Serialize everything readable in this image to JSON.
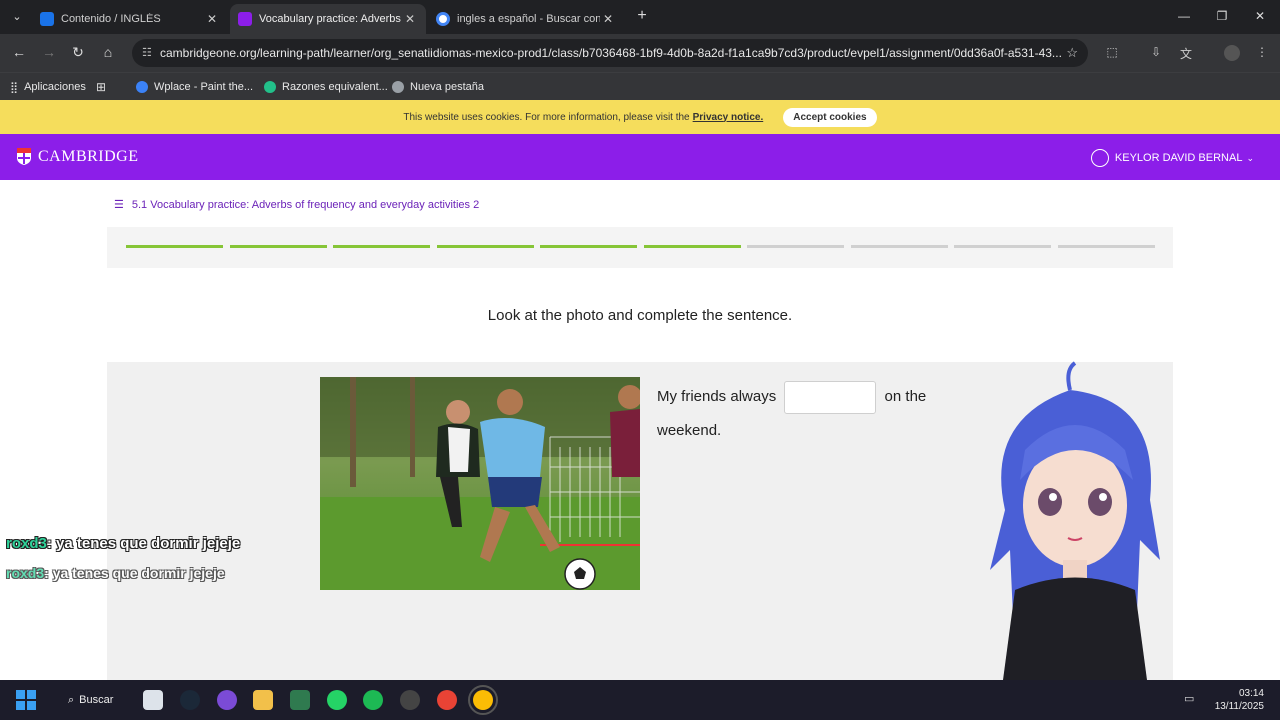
{
  "browser": {
    "tabs": [
      {
        "title": "Contenido / INGLÉS",
        "active": false,
        "favicon_color": "#1a73e8"
      },
      {
        "title": "Vocabulary practice: Adverbs of",
        "active": true,
        "favicon_color": "#8c1ee9"
      },
      {
        "title": "ingles a español - Buscar con G",
        "active": false,
        "favicon_color": "#4285f4"
      }
    ],
    "url": "cambridgeone.org/learning-path/learner/org_senatiidiomas-mexico-prod1/class/b7036468-1bf9-4d0b-8a2d-f1a1ca9b7cd3/product/evpel1/assignment/0dd36a0f-a531-43...",
    "bookmarks": [
      "Aplicaciones",
      "Wplace - Paint the...",
      "Razones equivalent...",
      "Nueva pestaña"
    ]
  },
  "cookie": {
    "message": "This website uses cookies. For more information, please visit the",
    "link": "Privacy notice.",
    "accept_label": "Accept cookies"
  },
  "header": {
    "logo_text": "CAMBRIDGE",
    "user_name": "KEYLOR DAVID BERNAL",
    "brand_color": "#8c1ee9"
  },
  "activity": {
    "breadcrumb": "5.1 Vocabulary practice: Adverbs of frequency and everyday activities 2",
    "progress": {
      "total": 10,
      "completed": 6
    },
    "instruction": "Look at the photo and complete the sentence.",
    "sentence_before": "My friends always",
    "sentence_after": "on the weekend.",
    "answer_value": ""
  },
  "overlay_chat": [
    {
      "user": "roxd3",
      "message": ": ya tenes que dormir jejeje"
    },
    {
      "user": "roxd3",
      "message": ": ya tenes que dormir jejeje"
    }
  ],
  "taskbar": {
    "search_label": "Buscar",
    "time": "03:14",
    "date": "13/11/2025"
  }
}
